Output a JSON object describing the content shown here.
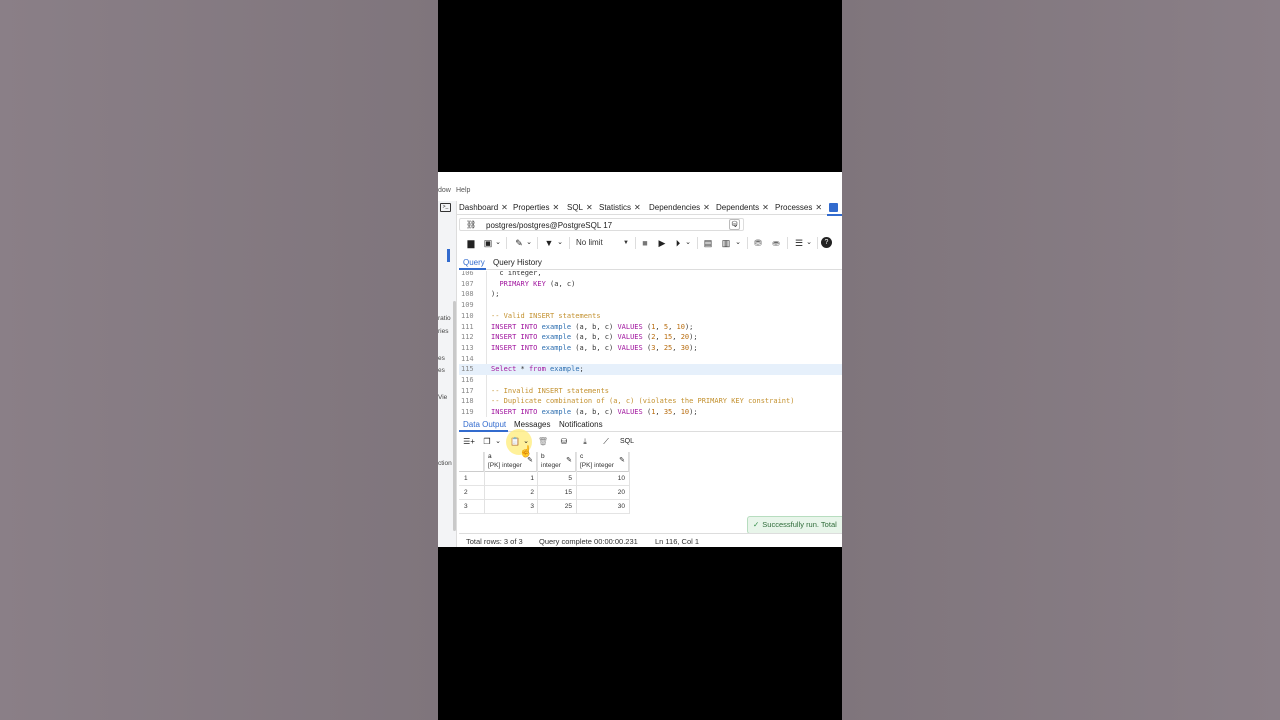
{
  "menu": {
    "window_fragment": "dow",
    "help": "Help"
  },
  "left_panel": {
    "fragments": [
      "ratio",
      "ries",
      "es",
      "es",
      "Vie",
      "ction"
    ]
  },
  "tabs": [
    {
      "label": "Dashboard"
    },
    {
      "label": "Properties"
    },
    {
      "label": "SQL"
    },
    {
      "label": "Statistics"
    },
    {
      "label": "Dependencies"
    },
    {
      "label": "Dependents"
    },
    {
      "label": "Processes"
    }
  ],
  "tab_close": "✕",
  "connection": {
    "label": "postgres/postgres@PostgreSQL 17"
  },
  "toolbar": {
    "limit_label": "No limit"
  },
  "query_tabs": {
    "query": "Query",
    "history": "Query History"
  },
  "editor": {
    "lines": [
      {
        "n": "106",
        "html": "<span>  c integer,</span>"
      },
      {
        "n": "107",
        "html": "  <span class=\"kw\">PRIMARY KEY</span> (a, c)"
      },
      {
        "n": "108",
        "html": ");"
      },
      {
        "n": "109",
        "html": ""
      },
      {
        "n": "110",
        "html": "<span class=\"cm\">-- Valid INSERT statements</span>"
      },
      {
        "n": "111",
        "html": "<span class=\"kw\">INSERT INTO</span> <span class=\"id\">example</span> (a, b, c) <span class=\"kw\">VALUES</span> (<span class=\"num\">1</span>, <span class=\"num\">5</span>, <span class=\"num\">10</span>);"
      },
      {
        "n": "112",
        "html": "<span class=\"kw\">INSERT INTO</span> <span class=\"id\">example</span> (a, b, c) <span class=\"kw\">VALUES</span> (<span class=\"num\">2</span>, <span class=\"num\">15</span>, <span class=\"num\">20</span>);"
      },
      {
        "n": "113",
        "html": "<span class=\"kw\">INSERT INTO</span> <span class=\"id\">example</span> (a, b, c) <span class=\"kw\">VALUES</span> (<span class=\"num\">3</span>, <span class=\"num\">25</span>, <span class=\"num\">30</span>);"
      },
      {
        "n": "114",
        "html": ""
      },
      {
        "n": "115",
        "html": "<span class=\"kw\">Select</span> * <span class=\"kw\">from</span> <span class=\"id\">example</span>;",
        "hl": true
      },
      {
        "n": "116",
        "html": ""
      },
      {
        "n": "117",
        "html": "<span class=\"cm\">-- Invalid INSERT statements</span>"
      },
      {
        "n": "118",
        "html": "<span class=\"cm\">-- Duplicate combination of (a, c) (violates the PRIMARY KEY constraint)</span>"
      },
      {
        "n": "119",
        "html": "<span class=\"kw\">INSERT INTO</span> <span class=\"id\">example</span> (a, b, c) <span class=\"kw\">VALUES</span> (<span class=\"num\">1</span>, <span class=\"num\">35</span>, <span class=\"num\">10</span>);"
      }
    ]
  },
  "output_tabs": {
    "data": "Data Output",
    "messages": "Messages",
    "notifications": "Notifications"
  },
  "sql_button": "SQL",
  "grid": {
    "columns": [
      {
        "name": "a",
        "type": "[PK] integer"
      },
      {
        "name": "b",
        "type": "integer"
      },
      {
        "name": "c",
        "type": "[PK] integer"
      }
    ],
    "rows": [
      {
        "n": "1",
        "a": "1",
        "b": "5",
        "c": "10"
      },
      {
        "n": "2",
        "a": "2",
        "b": "15",
        "c": "20"
      },
      {
        "n": "3",
        "a": "3",
        "b": "25",
        "c": "30"
      }
    ]
  },
  "toast": "Successfully run. Total",
  "status": {
    "rows": "Total rows: 3 of 3",
    "complete": "Query complete 00:00:00.231",
    "position": "Ln 116, Col 1"
  },
  "colors": {
    "accent": "#326bce",
    "keyword": "#a0149e",
    "identifier": "#2c6eb0",
    "number": "#b86c0e",
    "comment": "#c3912f",
    "success": "#2e8b44"
  }
}
